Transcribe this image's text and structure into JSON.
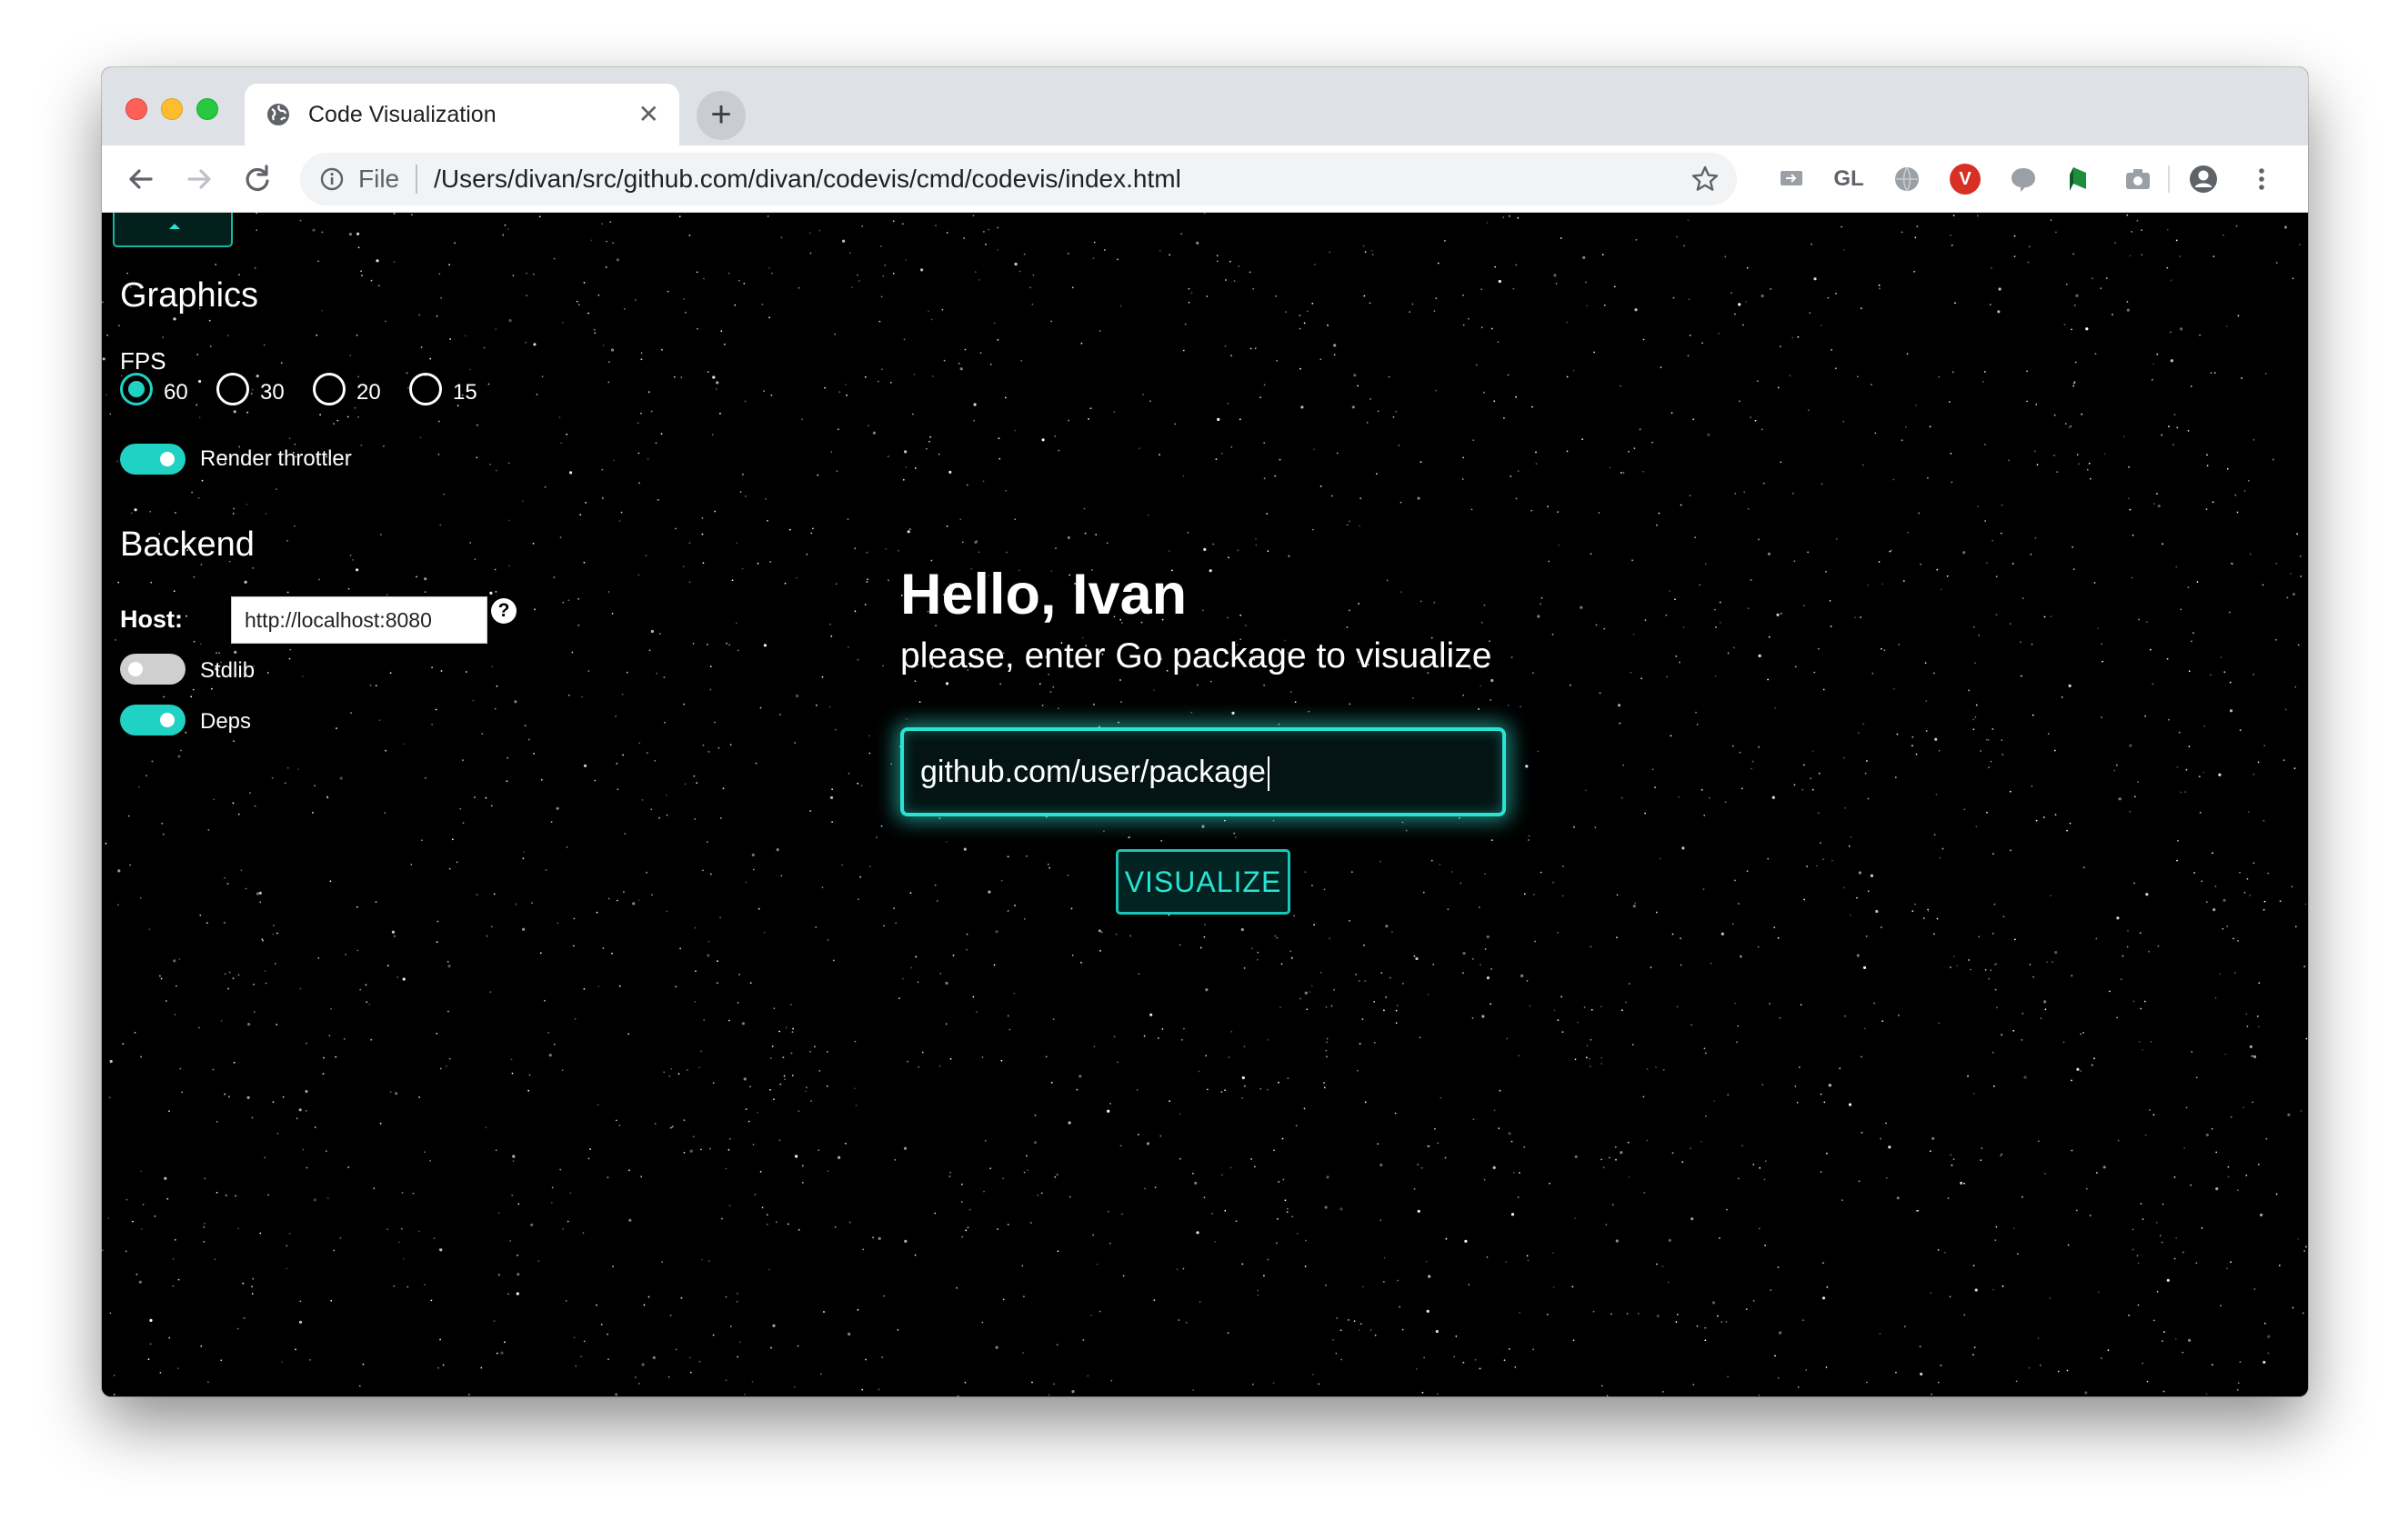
{
  "browser": {
    "tab_title": "Code Visualization",
    "tab_close": "✕",
    "new_tab": "+",
    "address": {
      "security_label": "File",
      "url": "/Users/divan/src/github.com/divan/codevis/cmd/codevis/index.html"
    },
    "extensions": [
      {
        "name": "screen-share-extension-icon"
      },
      {
        "name": "gl-extension-icon",
        "label": "GL"
      },
      {
        "name": "globe-extension-icon"
      },
      {
        "name": "v-extension-icon",
        "label": "V"
      },
      {
        "name": "chat-extension-icon"
      },
      {
        "name": "green-bookmark-extension-icon"
      },
      {
        "name": "camera-extension-icon"
      },
      {
        "name": "profile-icon"
      },
      {
        "name": "menu-dots-icon"
      }
    ]
  },
  "panel": {
    "graphics_title": "Graphics",
    "fps_label": "FPS",
    "fps_options": [
      "60",
      "30",
      "20",
      "15"
    ],
    "fps_selected": "60",
    "render_throttler_label": "Render throttler",
    "render_throttler_on": true,
    "backend_title": "Backend",
    "host_label": "Host:",
    "host_value": "http://localhost:8080",
    "help": "?",
    "stdlib_label": "Stdlib",
    "stdlib_on": false,
    "deps_label": "Deps",
    "deps_on": true
  },
  "main": {
    "greeting": "Hello, Ivan",
    "prompt": "please, enter Go package to visualize",
    "package_value": "github.com/user/package",
    "visualize_label": "VISUALIZE"
  },
  "colors": {
    "accent": "#1fd2c3",
    "glow": "#2be3d2",
    "background": "#000000"
  }
}
